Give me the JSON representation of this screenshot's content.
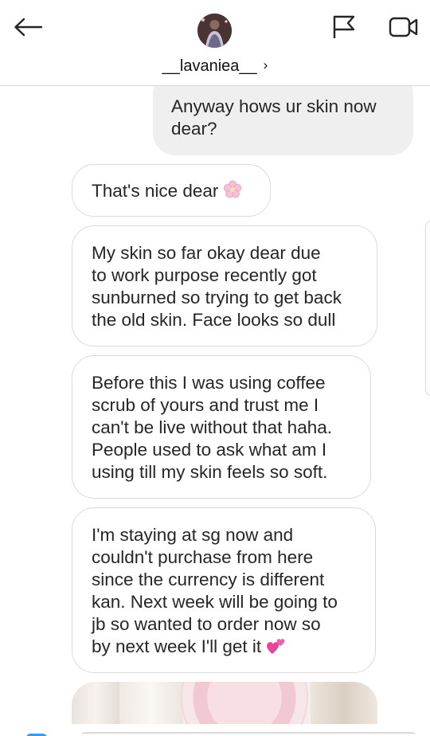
{
  "header": {
    "username": "__lavaniea__",
    "username_chevron": "›",
    "back_icon": "arrow-left-icon",
    "flag_icon": "flag-icon",
    "video_icon": "video-call-icon"
  },
  "messages": [
    {
      "sender": "me",
      "lines": [
        "Anyway hows ur skin now",
        "dear?"
      ]
    },
    {
      "sender": "them",
      "lines": [
        "That's nice dear"
      ],
      "emoji": "cherry-blossom-icon"
    },
    {
      "sender": "them",
      "lines": [
        "My skin so far okay dear due",
        "to work purpose recently got",
        "sunburned so trying to get back",
        "the old skin. Face looks so dull"
      ]
    },
    {
      "sender": "them",
      "lines": [
        "Before this I was using coffee",
        "scrub of yours and trust me I",
        "can't be live without that haha.",
        "People used to ask what am I",
        "using till my skin feels so soft."
      ]
    },
    {
      "sender": "them",
      "lines": [
        "I'm staying at sg now and",
        "couldn't purchase from here",
        "since the currency is different",
        "kan. Next week will be going to",
        "jb so wanted to order now so",
        "by next week I'll get it"
      ],
      "emoji": "two-hearts-icon"
    }
  ],
  "attachment": {
    "type": "image",
    "icon": "image-thumbnail"
  },
  "colors": {
    "my_bubble": "#efefef",
    "their_border": "#dbdbdb",
    "text": "#262626",
    "accent": "#3897f0",
    "heart_pink": "#e8449a",
    "blossom_pink": "#f6b8cf"
  }
}
